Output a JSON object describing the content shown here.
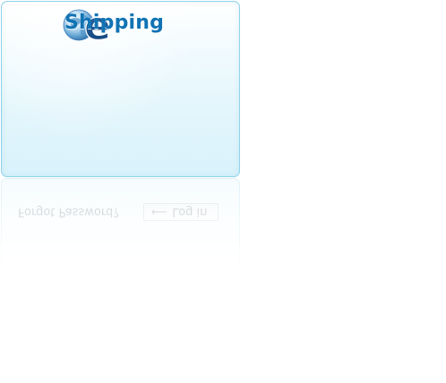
{
  "brand": {
    "name": "Shipping",
    "logo_letter": "e",
    "colors": {
      "brand_blue": "#1173b4",
      "globe_dark": "#1b4f86",
      "card_border": "#8fd3ea",
      "card_bg_bottom": "#d8f2fb"
    }
  },
  "reflection": {
    "password_label": "Forgot Password?",
    "login_button_label": "Log in",
    "login_icon": "arrow-icon"
  }
}
